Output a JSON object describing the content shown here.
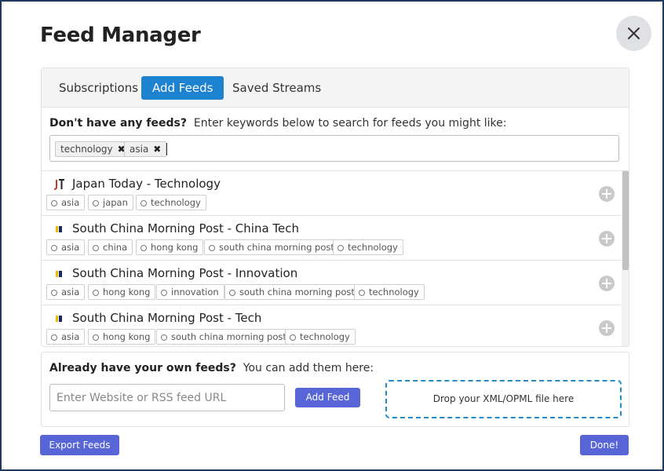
{
  "dialog": {
    "title": "Feed Manager"
  },
  "tabs": [
    {
      "label": "Subscriptions",
      "active": false
    },
    {
      "label": "Add Feeds",
      "active": true
    },
    {
      "label": "Saved Streams",
      "active": false
    }
  ],
  "search": {
    "prompt_bold": "Don't have any feeds?",
    "prompt_rest": "Enter keywords below to search for feeds you might like:",
    "chips": [
      "technology",
      "asia"
    ]
  },
  "results": [
    {
      "title": "Japan Today - Technology",
      "icon": "japan-today-logo",
      "tags": [
        "asia",
        "japan",
        "technology"
      ]
    },
    {
      "title": "South China Morning Post - China Tech",
      "icon": "scmp-logo",
      "tags": [
        "asia",
        "china",
        "hong kong",
        "south china morning post",
        "technology"
      ]
    },
    {
      "title": "South China Morning Post - Innovation",
      "icon": "scmp-logo",
      "tags": [
        "asia",
        "hong kong",
        "innovation",
        "south china morning post",
        "technology"
      ]
    },
    {
      "title": "South China Morning Post - Tech",
      "icon": "scmp-logo",
      "tags": [
        "asia",
        "hong kong",
        "south china morning post",
        "technology"
      ]
    }
  ],
  "own_feeds": {
    "prompt_bold": "Already have your own feeds?",
    "prompt_rest": "You can add them here:",
    "url_placeholder": "Enter Website or RSS feed URL",
    "add_button": "Add Feed",
    "drop_zone": "Drop your XML/OPML file here"
  },
  "footer": {
    "export_button": "Export Feeds",
    "done_button": "Done!"
  },
  "colors": {
    "active_tab": "#1d82cf",
    "button": "#5865d6",
    "drop_border": "#2389c9",
    "frame_border": "#1f3a5f"
  }
}
